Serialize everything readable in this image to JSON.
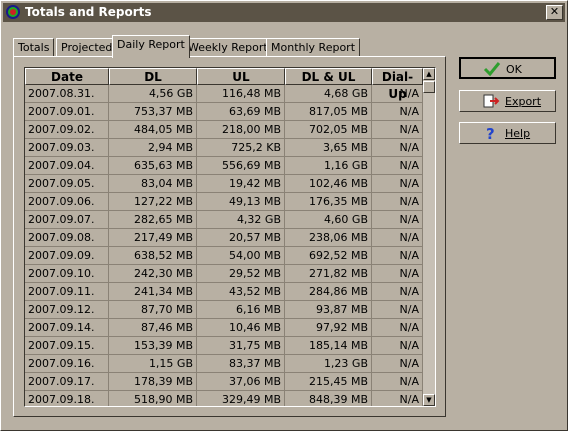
{
  "window": {
    "title": "Totals and Reports",
    "close_glyph": "✕",
    "app_icon": "target-icon"
  },
  "tabs": [
    {
      "label": "Totals",
      "active": false
    },
    {
      "label": "Projected",
      "active": false
    },
    {
      "label": "Daily Report",
      "active": true
    },
    {
      "label": "Weekly Report",
      "active": false
    },
    {
      "label": "Monthly Report",
      "active": false
    }
  ],
  "table": {
    "columns": [
      "Date",
      "DL",
      "UL",
      "DL & UL",
      "Dial-Up"
    ],
    "rows": [
      [
        "2007.08.31.",
        "4,56 GB",
        "116,48 MB",
        "4,68 GB",
        "N/A"
      ],
      [
        "2007.09.01.",
        "753,37 MB",
        "63,69 MB",
        "817,05 MB",
        "N/A"
      ],
      [
        "2007.09.02.",
        "484,05 MB",
        "218,00 MB",
        "702,05 MB",
        "N/A"
      ],
      [
        "2007.09.03.",
        "2,94 MB",
        "725,2 KB",
        "3,65 MB",
        "N/A"
      ],
      [
        "2007.09.04.",
        "635,63 MB",
        "556,69 MB",
        "1,16 GB",
        "N/A"
      ],
      [
        "2007.09.05.",
        "83,04 MB",
        "19,42 MB",
        "102,46 MB",
        "N/A"
      ],
      [
        "2007.09.06.",
        "127,22 MB",
        "49,13 MB",
        "176,35 MB",
        "N/A"
      ],
      [
        "2007.09.07.",
        "282,65 MB",
        "4,32 GB",
        "4,60 GB",
        "N/A"
      ],
      [
        "2007.09.08.",
        "217,49 MB",
        "20,57 MB",
        "238,06 MB",
        "N/A"
      ],
      [
        "2007.09.09.",
        "638,52 MB",
        "54,00 MB",
        "692,52 MB",
        "N/A"
      ],
      [
        "2007.09.10.",
        "242,30 MB",
        "29,52 MB",
        "271,82 MB",
        "N/A"
      ],
      [
        "2007.09.11.",
        "241,34 MB",
        "43,52 MB",
        "284,86 MB",
        "N/A"
      ],
      [
        "2007.09.12.",
        "87,70 MB",
        "6,16 MB",
        "93,87 MB",
        "N/A"
      ],
      [
        "2007.09.14.",
        "87,46 MB",
        "10,46 MB",
        "97,92 MB",
        "N/A"
      ],
      [
        "2007.09.15.",
        "153,39 MB",
        "31,75 MB",
        "185,14 MB",
        "N/A"
      ],
      [
        "2007.09.16.",
        "1,15 GB",
        "83,37 MB",
        "1,23 GB",
        "N/A"
      ],
      [
        "2007.09.17.",
        "178,39 MB",
        "37,06 MB",
        "215,45 MB",
        "N/A"
      ],
      [
        "2007.09.18.",
        "518,90 MB",
        "329,49 MB",
        "848,39 MB",
        "N/A"
      ]
    ]
  },
  "scrollbar": {
    "up_glyph": "▲",
    "down_glyph": "▼"
  },
  "buttons": {
    "ok": "OK",
    "export": "Export",
    "help": "Help"
  },
  "colors": {
    "titlebar": "#5b5346",
    "face": "#b8b0a3",
    "ok_check": "#2e9e2e",
    "help_icon": "#2244cc",
    "export_icon": "#cc2222"
  }
}
